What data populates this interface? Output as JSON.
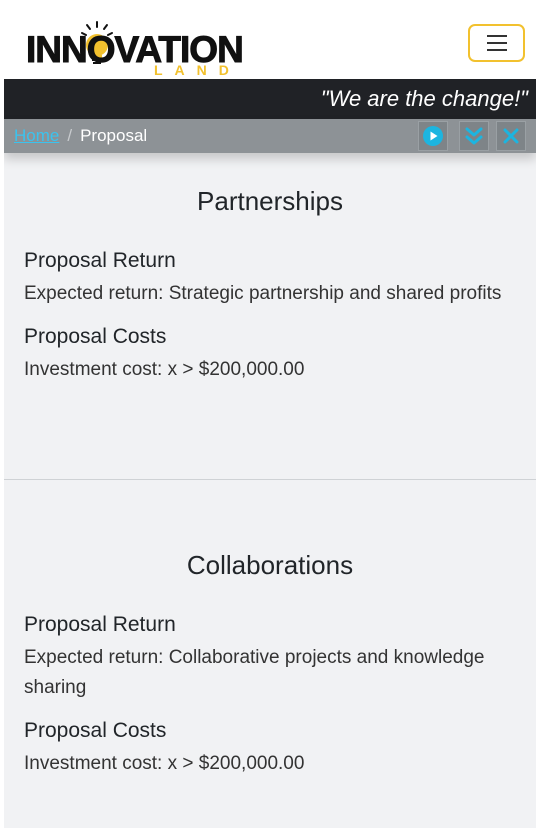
{
  "brand": {
    "logo_main": "INNOVATION",
    "logo_sub": "LAND",
    "logo_accent": "#f2c12e"
  },
  "header": {
    "tagline": "\"We are the change!\""
  },
  "breadcrumb": {
    "home": "Home",
    "separator": "/",
    "current": "Proposal"
  },
  "controls": {
    "play_icon": "play-circle-icon",
    "expand_icon": "double-chevron-down-icon",
    "close_icon": "close-icon",
    "accent": "#1cb5e0"
  },
  "sections": [
    {
      "title": "Partnerships",
      "return_heading": "Proposal Return",
      "return_text": "Expected return: Strategic partnership and shared profits",
      "costs_heading": "Proposal Costs",
      "costs_text": "Investment cost: x > $200,000.00"
    },
    {
      "title": "Collaborations",
      "return_heading": "Proposal Return",
      "return_text": "Expected return: Collaborative projects and knowledge sharing",
      "costs_heading": "Proposal Costs",
      "costs_text": "Investment cost: x > $200,000.00"
    }
  ]
}
